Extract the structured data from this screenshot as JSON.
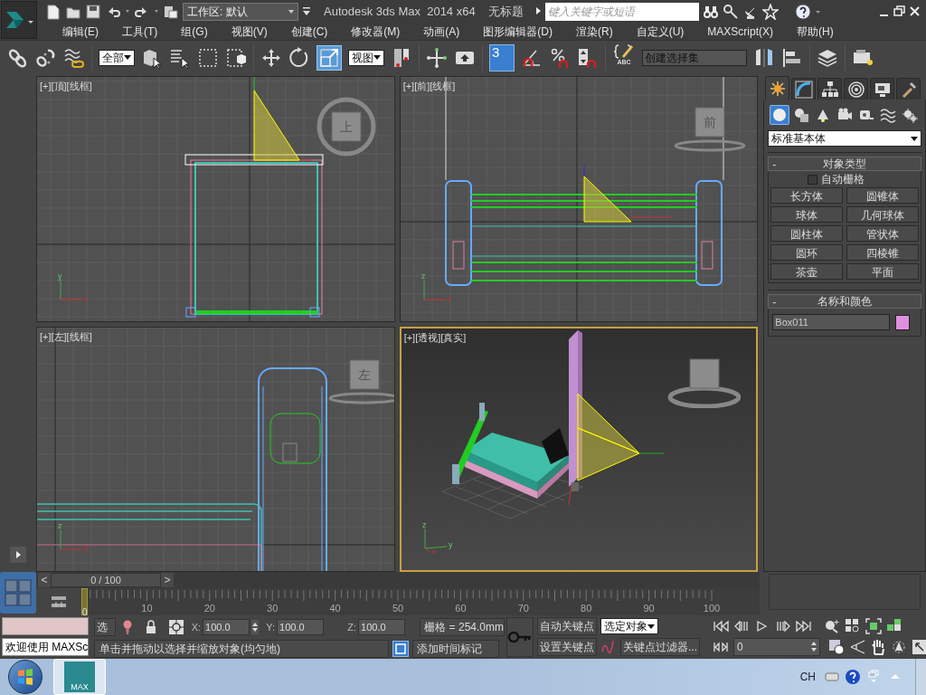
{
  "title_bar": {
    "workspace": "工作区: 默认",
    "title": "Autodesk 3ds Max  2014 x64",
    "document": "无标题",
    "search_placeholder": "键入关键字或短语"
  },
  "menus": [
    {
      "label": "编辑(E)"
    },
    {
      "label": "工具(T)"
    },
    {
      "label": "组(G)"
    },
    {
      "label": "视图(V)"
    },
    {
      "label": "创建(C)"
    },
    {
      "label": "修改器(M)"
    },
    {
      "label": "动画(A)"
    },
    {
      "label": "图形编辑器(D)"
    },
    {
      "label": "渲染(R)"
    },
    {
      "label": "自定义(U)"
    },
    {
      "label": "MAXScript(X)"
    },
    {
      "label": "帮助(H)"
    }
  ],
  "toolbar": {
    "selection_filter": "全部",
    "scale_selected": true,
    "reference_coordinates": "视图",
    "snap_label": "3",
    "snap_on": true,
    "edit_named_label": "ABC",
    "named_selection_placeholder": "创建选择集"
  },
  "viewports": [
    {
      "kind": "top",
      "labels": [
        "[+]",
        "[顶]",
        "[线框]"
      ],
      "viewcube": "上",
      "axes": [
        "y",
        "x"
      ],
      "selected": false
    },
    {
      "kind": "front",
      "labels": [
        "[+]",
        "[前]",
        "[线框]"
      ],
      "viewcube": "前",
      "axes": [
        "z",
        "x"
      ],
      "selected": false
    },
    {
      "kind": "left",
      "labels": [
        "[+]",
        "[左]",
        "[线框]"
      ],
      "viewcube": "左",
      "axes": [
        "z",
        "y"
      ],
      "selected": false
    },
    {
      "kind": "perspective",
      "labels": [
        "[+]",
        "[透视]",
        "[真实]"
      ],
      "axes": [
        "z",
        "y",
        "x"
      ],
      "selected": true
    }
  ],
  "command_panel": {
    "tabs": [
      {
        "selected": true
      },
      {
        "selected": false
      },
      {
        "selected": false
      },
      {
        "selected": false
      },
      {
        "selected": false
      },
      {
        "selected": false
      }
    ],
    "categories": [
      {
        "selected": true
      },
      {
        "selected": false
      },
      {
        "selected": false
      },
      {
        "selected": false
      },
      {
        "selected": false
      },
      {
        "selected": false
      },
      {
        "selected": false
      }
    ],
    "dropdown": "标准基本体",
    "object_type": {
      "toggle": "-",
      "title": "对象类型",
      "auto_grid": {
        "label": "自动栅格",
        "checked": false
      },
      "buttons": [
        "长方体",
        "圆锥体",
        "球体",
        "几何球体",
        "圆柱体",
        "管状体",
        "圆环",
        "四棱锥",
        "茶壶",
        "平面"
      ]
    },
    "name_color": {
      "toggle": "-",
      "title": "名称和颜色",
      "name": "Box011"
    }
  },
  "time_slider": {
    "prev": "<",
    "label": "0 / 100",
    "next": ">"
  },
  "track_bar": {
    "current": "0",
    "ticks": [
      "10",
      "20",
      "30",
      "40",
      "50",
      "60",
      "70",
      "80",
      "90",
      "100"
    ]
  },
  "listener": {
    "output": "欢迎使用 MAXSc"
  },
  "status": {
    "selection": "选",
    "coords": [
      {
        "axis": "X:",
        "value": "100.0"
      },
      {
        "axis": "Y:",
        "value": "100.0"
      },
      {
        "axis": "Z:",
        "value": "100.0"
      }
    ],
    "grid": "栅格 = 254.0mm",
    "prompt": "单击并拖动以选择并缩放对象(均匀地)",
    "time_tag": "添加时间标记",
    "auto_key": "自动关键点",
    "key_mode": "选定对象",
    "set_key": "设置关键点",
    "key_filters": "关键点过滤器...",
    "frame": "0"
  },
  "taskbar": {
    "app_label": "MAX",
    "language": "CH"
  }
}
